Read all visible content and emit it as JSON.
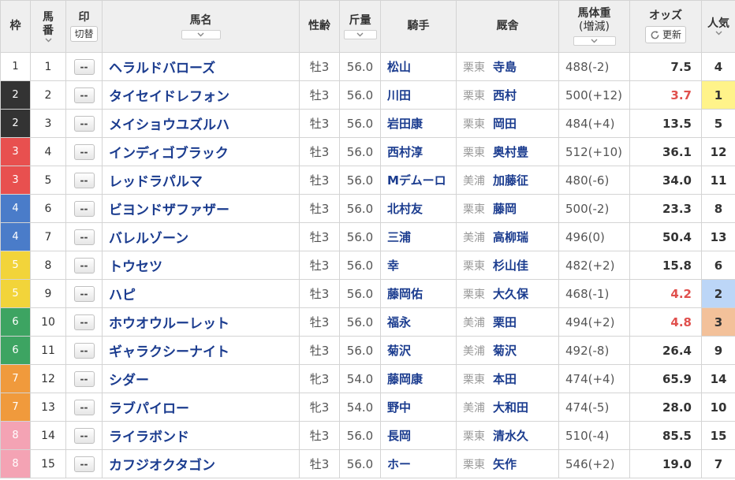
{
  "headers": {
    "waku": "枠",
    "umaban": [
      "馬",
      "番"
    ],
    "mark": "印",
    "mark_toggle": "切替",
    "name": "馬名",
    "sexage": "性齢",
    "kinryo": "斤量",
    "jockey": "騎手",
    "trainer": "厩舎",
    "weight": "馬体重",
    "weight_sub": "(増減)",
    "odds": "オッズ",
    "odds_refresh": "更新",
    "ninki": "人気"
  },
  "mark_placeholder": "--",
  "waku_colors": {
    "1": {
      "bg": "#ffffff",
      "fg": "#333333"
    },
    "2": {
      "bg": "#333333",
      "fg": "#ffffff"
    },
    "3": {
      "bg": "#e8504f",
      "fg": "#ffffff"
    },
    "4": {
      "bg": "#4a7cc9",
      "fg": "#ffffff"
    },
    "5": {
      "bg": "#f2d43a",
      "fg": "#ffffff"
    },
    "6": {
      "bg": "#3da462",
      "fg": "#ffffff"
    },
    "7": {
      "bg": "#f09a3c",
      "fg": "#ffffff"
    },
    "8": {
      "bg": "#f4a3b4",
      "fg": "#ffffff"
    }
  },
  "popularity_colors": {
    "1": "#fff38a",
    "2": "#bcd6f7",
    "3": "#f3c19a"
  },
  "horses": [
    {
      "waku": "1",
      "umaban": "1",
      "name": "ヘラルドバローズ",
      "sexage": "牡3",
      "kinryo": "56.0",
      "jockey": "松山",
      "area": "栗東",
      "trainer": "寺島",
      "weight": "488(-2)",
      "odds": "7.5",
      "ninki": "4"
    },
    {
      "waku": "2",
      "umaban": "2",
      "name": "タイセイドレフォン",
      "sexage": "牡3",
      "kinryo": "56.0",
      "jockey": "川田",
      "area": "栗東",
      "trainer": "西村",
      "weight": "500(+12)",
      "odds": "3.7",
      "ninki": "1"
    },
    {
      "waku": "2",
      "umaban": "3",
      "name": "メイショウユズルハ",
      "sexage": "牡3",
      "kinryo": "56.0",
      "jockey": "岩田康",
      "area": "栗東",
      "trainer": "岡田",
      "weight": "484(+4)",
      "odds": "13.5",
      "ninki": "5"
    },
    {
      "waku": "3",
      "umaban": "4",
      "name": "インディゴブラック",
      "sexage": "牡3",
      "kinryo": "56.0",
      "jockey": "西村淳",
      "area": "栗東",
      "trainer": "奥村豊",
      "weight": "512(+10)",
      "odds": "36.1",
      "ninki": "12"
    },
    {
      "waku": "3",
      "umaban": "5",
      "name": "レッドラパルマ",
      "sexage": "牡3",
      "kinryo": "56.0",
      "jockey": "Mデムーロ",
      "area": "美浦",
      "trainer": "加藤征",
      "weight": "480(-6)",
      "odds": "34.0",
      "ninki": "11"
    },
    {
      "waku": "4",
      "umaban": "6",
      "name": "ビヨンドザファザー",
      "sexage": "牡3",
      "kinryo": "56.0",
      "jockey": "北村友",
      "area": "栗東",
      "trainer": "藤岡",
      "weight": "500(-2)",
      "odds": "23.3",
      "ninki": "8"
    },
    {
      "waku": "4",
      "umaban": "7",
      "name": "バレルゾーン",
      "sexage": "牡3",
      "kinryo": "56.0",
      "jockey": "三浦",
      "area": "美浦",
      "trainer": "高柳瑞",
      "weight": "496(0)",
      "odds": "50.4",
      "ninki": "13"
    },
    {
      "waku": "5",
      "umaban": "8",
      "name": "トウセツ",
      "sexage": "牡3",
      "kinryo": "56.0",
      "jockey": "幸",
      "area": "栗東",
      "trainer": "杉山佳",
      "weight": "482(+2)",
      "odds": "15.8",
      "ninki": "6"
    },
    {
      "waku": "5",
      "umaban": "9",
      "name": "ハピ",
      "sexage": "牡3",
      "kinryo": "56.0",
      "jockey": "藤岡佑",
      "area": "栗東",
      "trainer": "大久保",
      "weight": "468(-1)",
      "odds": "4.2",
      "ninki": "2"
    },
    {
      "waku": "6",
      "umaban": "10",
      "name": "ホウオウルーレット",
      "sexage": "牡3",
      "kinryo": "56.0",
      "jockey": "福永",
      "area": "美浦",
      "trainer": "栗田",
      "weight": "494(+2)",
      "odds": "4.8",
      "ninki": "3"
    },
    {
      "waku": "6",
      "umaban": "11",
      "name": "ギャラクシーナイト",
      "sexage": "牡3",
      "kinryo": "56.0",
      "jockey": "菊沢",
      "area": "美浦",
      "trainer": "菊沢",
      "weight": "492(-8)",
      "odds": "26.4",
      "ninki": "9"
    },
    {
      "waku": "7",
      "umaban": "12",
      "name": "シダー",
      "sexage": "牝3",
      "kinryo": "54.0",
      "jockey": "藤岡康",
      "area": "栗東",
      "trainer": "本田",
      "weight": "474(+4)",
      "odds": "65.9",
      "ninki": "14"
    },
    {
      "waku": "7",
      "umaban": "13",
      "name": "ラブパイロー",
      "sexage": "牝3",
      "kinryo": "54.0",
      "jockey": "野中",
      "area": "美浦",
      "trainer": "大和田",
      "weight": "474(-5)",
      "odds": "28.0",
      "ninki": "10"
    },
    {
      "waku": "8",
      "umaban": "14",
      "name": "ライラボンド",
      "sexage": "牡3",
      "kinryo": "56.0",
      "jockey": "長岡",
      "area": "栗東",
      "trainer": "清水久",
      "weight": "510(-4)",
      "odds": "85.5",
      "ninki": "15"
    },
    {
      "waku": "8",
      "umaban": "15",
      "name": "カフジオクタゴン",
      "sexage": "牡3",
      "kinryo": "56.0",
      "jockey": "ホー",
      "area": "栗東",
      "trainer": "矢作",
      "weight": "546(+2)",
      "odds": "19.0",
      "ninki": "7"
    }
  ]
}
